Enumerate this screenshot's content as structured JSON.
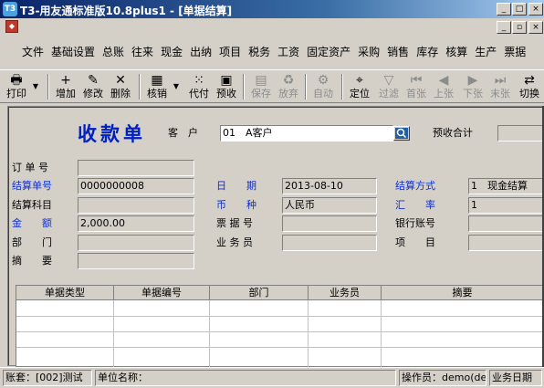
{
  "window": {
    "title": "T3-用友通标准版10.8plus1 - [单据结算]",
    "app_icon": "T3",
    "buttons": [
      "_",
      "□",
      "×"
    ]
  },
  "menu": {
    "items": [
      "文件",
      "基础设置",
      "总账",
      "往来",
      "现金",
      "出纳",
      "项目",
      "税务",
      "工资",
      "固定资产",
      "采购",
      "销售",
      "库存",
      "核算",
      "生产",
      "票据"
    ],
    "doc_buttons": [
      "_",
      "▫",
      "×"
    ]
  },
  "toolbar": {
    "buttons": [
      {
        "label": "打印",
        "icon": "printer-icon",
        "glyph": "🖶",
        "enabled": true
      },
      {
        "label": "增加",
        "icon": "add-icon",
        "glyph": "+",
        "enabled": true
      },
      {
        "label": "修改",
        "icon": "edit-icon",
        "glyph": "✎",
        "enabled": true
      },
      {
        "label": "删除",
        "icon": "delete-icon",
        "glyph": "✕",
        "enabled": true
      },
      {
        "label": "核销",
        "icon": "verify-icon",
        "glyph": "▦",
        "enabled": true
      },
      {
        "label": "代付",
        "icon": "pay-on-behalf-icon",
        "glyph": "⁙",
        "enabled": true
      },
      {
        "label": "预收",
        "icon": "prepaid-icon",
        "glyph": "▣",
        "enabled": true
      },
      {
        "label": "保存",
        "icon": "save-icon",
        "glyph": "▤",
        "enabled": false
      },
      {
        "label": "放弃",
        "icon": "discard-icon",
        "glyph": "♻",
        "enabled": false
      },
      {
        "label": "自动",
        "icon": "auto-icon",
        "glyph": "⚙",
        "enabled": false
      },
      {
        "label": "定位",
        "icon": "locate-icon",
        "glyph": "⌖",
        "enabled": true
      },
      {
        "label": "过滤",
        "icon": "filter-icon",
        "glyph": "▽",
        "enabled": false
      },
      {
        "label": "首张",
        "icon": "first-record-icon",
        "glyph": "⏮",
        "enabled": false
      },
      {
        "label": "上张",
        "icon": "previous-record-icon",
        "glyph": "◀",
        "enabled": false
      },
      {
        "label": "下张",
        "icon": "next-record-icon",
        "glyph": "▶",
        "enabled": false
      },
      {
        "label": "末张",
        "icon": "last-record-icon",
        "glyph": "⏭",
        "enabled": false
      },
      {
        "label": "切换",
        "icon": "switch-icon",
        "glyph": "⇄",
        "enabled": true
      }
    ]
  },
  "form": {
    "title": "收款单",
    "customer_label": "客　户",
    "customer_value": "01　A客户",
    "prepaid_total_label": "预收合计",
    "prepaid_total_value": "",
    "order_no_label": "订 单 号",
    "order_no_value": "",
    "doc_no_label": "结算单号",
    "doc_no_value": "0000000008",
    "date_label": "日　　期",
    "date_value": "2013-08-10",
    "settle_method_label": "结算方式",
    "settle_method_value": "1　现金结算",
    "settle_subject_label": "结算科目",
    "settle_subject_value": "",
    "currency_label": "币　　种",
    "currency_value": "人民币",
    "exchange_rate_label": "汇　　率",
    "exchange_rate_value": "1",
    "amount_label": "金　　额",
    "amount_value": "2,000.00",
    "bill_no_label": "票 据 号",
    "bill_no_value": "",
    "bank_account_label": "银行账号",
    "bank_account_value": "",
    "department_label": "部　　门",
    "department_value": "",
    "salesperson_label": "业 务 员",
    "salesperson_value": "",
    "project_label": "项　　目",
    "project_value": "",
    "summary_label": "摘　　要",
    "summary_value": ""
  },
  "grid": {
    "columns": [
      "单据类型",
      "单据编号",
      "部门",
      "业务员",
      "摘要"
    ]
  },
  "status": {
    "account_set": "账套：[002]测试",
    "unit_name": "单位名称：",
    "operator": "操作员：demo(de",
    "business_date": "业务日期"
  }
}
